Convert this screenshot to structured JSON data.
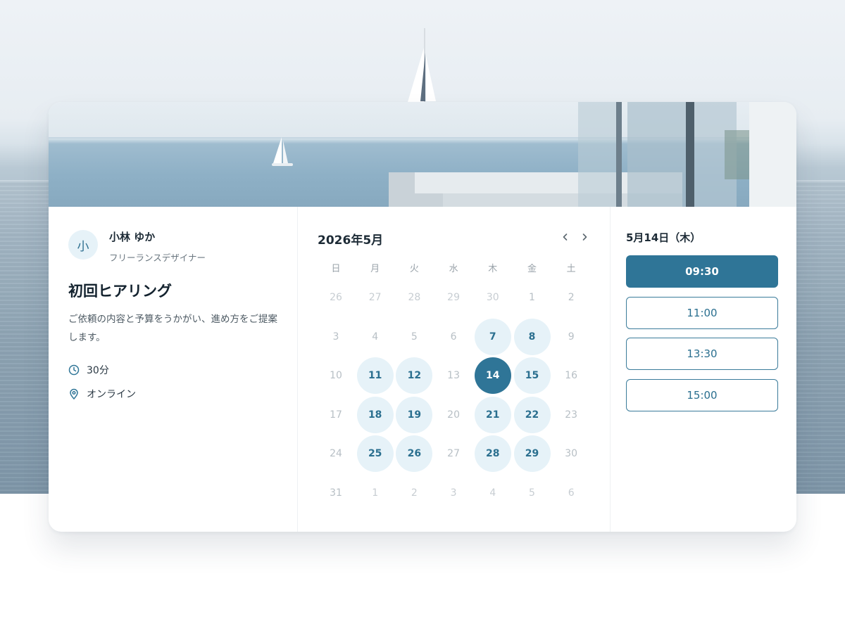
{
  "host": {
    "avatar_initial": "小",
    "name": "小林 ゆか",
    "role": "フリーランスデザイナー"
  },
  "event": {
    "title": "初回ヒアリング",
    "description": "ご依頼の内容と予算をうかがい、進め方をご提案します。",
    "duration": "30分",
    "location": "オンライン",
    "duration_icon": "clock-icon",
    "location_icon": "map-pin-icon"
  },
  "calendar": {
    "month_label": "2026年5月",
    "prev_icon": "chevron-left-icon",
    "next_icon": "chevron-right-icon",
    "weekdays": [
      "日",
      "月",
      "火",
      "水",
      "木",
      "金",
      "土"
    ],
    "weeks": [
      [
        {
          "d": "26",
          "s": "out"
        },
        {
          "d": "27",
          "s": "out"
        },
        {
          "d": "28",
          "s": "out"
        },
        {
          "d": "29",
          "s": "out"
        },
        {
          "d": "30",
          "s": "out"
        },
        {
          "d": "1",
          "s": "in"
        },
        {
          "d": "2",
          "s": "in"
        }
      ],
      [
        {
          "d": "3",
          "s": "in"
        },
        {
          "d": "4",
          "s": "in"
        },
        {
          "d": "5",
          "s": "in"
        },
        {
          "d": "6",
          "s": "in"
        },
        {
          "d": "7",
          "s": "available"
        },
        {
          "d": "8",
          "s": "available"
        },
        {
          "d": "9",
          "s": "in"
        }
      ],
      [
        {
          "d": "10",
          "s": "in"
        },
        {
          "d": "11",
          "s": "available"
        },
        {
          "d": "12",
          "s": "available"
        },
        {
          "d": "13",
          "s": "in"
        },
        {
          "d": "14",
          "s": "selected"
        },
        {
          "d": "15",
          "s": "available"
        },
        {
          "d": "16",
          "s": "in"
        }
      ],
      [
        {
          "d": "17",
          "s": "in"
        },
        {
          "d": "18",
          "s": "available"
        },
        {
          "d": "19",
          "s": "available"
        },
        {
          "d": "20",
          "s": "in"
        },
        {
          "d": "21",
          "s": "available"
        },
        {
          "d": "22",
          "s": "available"
        },
        {
          "d": "23",
          "s": "in"
        }
      ],
      [
        {
          "d": "24",
          "s": "in"
        },
        {
          "d": "25",
          "s": "available"
        },
        {
          "d": "26",
          "s": "available"
        },
        {
          "d": "27",
          "s": "in"
        },
        {
          "d": "28",
          "s": "available"
        },
        {
          "d": "29",
          "s": "available"
        },
        {
          "d": "30",
          "s": "in"
        }
      ],
      [
        {
          "d": "31",
          "s": "in"
        },
        {
          "d": "1",
          "s": "out"
        },
        {
          "d": "2",
          "s": "out"
        },
        {
          "d": "3",
          "s": "out"
        },
        {
          "d": "4",
          "s": "out"
        },
        {
          "d": "5",
          "s": "out"
        },
        {
          "d": "6",
          "s": "out"
        }
      ]
    ]
  },
  "slots": {
    "date_label": "5月14日（木）",
    "times": [
      {
        "label": "09:30",
        "active": true
      },
      {
        "label": "11:00",
        "active": false
      },
      {
        "label": "13:30",
        "active": false
      },
      {
        "label": "15:00",
        "active": false
      }
    ]
  },
  "colors": {
    "accent": "#2f7597",
    "available_bg": "#e6f2f8",
    "available_text": "#2a6f8f"
  }
}
